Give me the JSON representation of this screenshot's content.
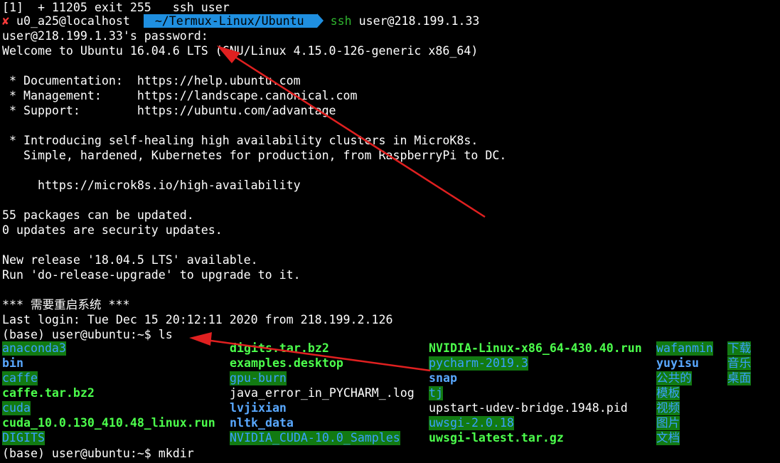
{
  "terminal": {
    "line_job": "[1]  + 11205 exit 255   ssh user",
    "prompt": {
      "x_mark": "✘",
      "host": " u0_a25@localhost ",
      "path": " ~/Termux-Linux/Ubuntu ",
      "cmd_word": "ssh",
      "cmd_rest": " user@218.199.1.33"
    },
    "line_password": "user@218.199.1.33's password:",
    "line_welcome": "Welcome to Ubuntu 16.04.6 LTS (GNU/Linux 4.15.0-126-generic x86_64)",
    "line_doc": " * Documentation:  https://help.ubuntu.com",
    "line_mgmt": " * Management:     https://landscape.canonical.com",
    "line_support": " * Support:        https://ubuntu.com/advantage",
    "line_intro1": " * Introducing self-healing high availability clusters in MicroK8s.",
    "line_intro2": "   Simple, hardened, Kubernetes for production, from RaspberryPi to DC.",
    "line_microk8s": "     https://microk8s.io/high-availability",
    "line_packages": "55 packages can be updated.",
    "line_security": "0 updates are security updates.",
    "line_release": "New release '18.04.5 LTS' available.",
    "line_upgrade": "Run 'do-release-upgrade' to upgrade to it.",
    "line_reboot": "*** 需要重启系统 ***",
    "line_lastlogin": "Last login: Tue Dec 15 20:12:11 2020 from 218.199.2.126",
    "line_ls_cmd": "(base) user@ubuntu:~$ ls",
    "line_mkdir_cmd": "(base) user@ubuntu:~$ mkdir"
  },
  "ls_output": {
    "col1": [
      "anaconda3",
      "bin",
      "caffe",
      "caffe.tar.bz2",
      "cuda",
      "cuda_10.0.130_410.48_linux.run",
      "DIGITS"
    ],
    "col2": [
      "digits.tar.bz2",
      "examples.desktop",
      "gpu-burn",
      "java_error_in_PYCHARM_.log",
      "lvjixian",
      "nltk_data",
      "NVIDIA_CUDA-10.0_Samples"
    ],
    "col3": [
      "NVIDIA-Linux-x86_64-430.40.run",
      "pycharm-2019.3",
      "snap",
      "tj",
      "upstart-udev-bridge.1948.pid",
      "uwsgi-2.0.18",
      "uwsgi-latest.tar.gz"
    ],
    "col4": [
      "wafanmin",
      "yuyisu",
      "公共的",
      "模板",
      "视频",
      "图片",
      "文档"
    ],
    "col5": [
      "下载",
      "音乐",
      "桌面"
    ]
  },
  "colors": {
    "background": "#000000",
    "path_segment": "#1f8fe0",
    "error_mark": "#ff3b3b",
    "ssh_command": "#2fb52f",
    "annotation_arrow": "#e02020"
  }
}
